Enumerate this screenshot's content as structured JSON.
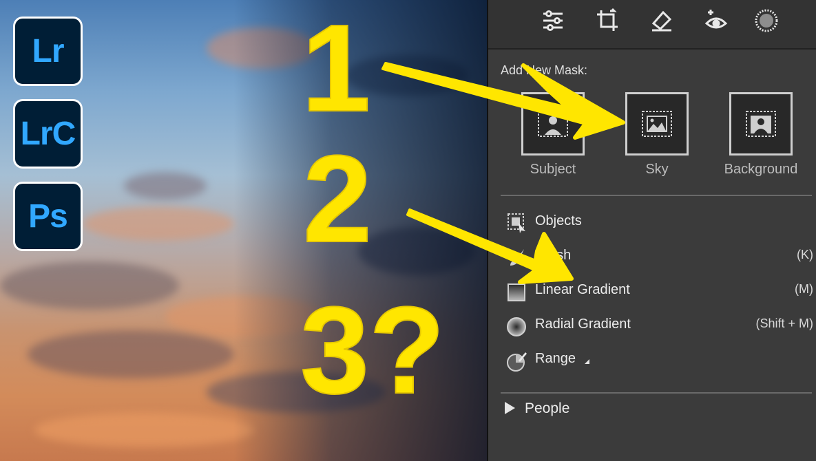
{
  "apps": [
    {
      "name": "lightroom-icon",
      "label": "Lr"
    },
    {
      "name": "lightroom-classic-icon",
      "label": "LrC"
    },
    {
      "name": "photoshop-icon",
      "label": "Ps"
    }
  ],
  "overlay": {
    "num1": "1",
    "num2": "2",
    "num3": "3?"
  },
  "toolbar": {
    "tools": [
      "sliders-icon",
      "crop-icon",
      "eraser-icon",
      "redeye-icon",
      "masking-icon"
    ]
  },
  "mask": {
    "add_label": "Add New Mask:",
    "buttons": [
      {
        "label": "Subject"
      },
      {
        "label": "Sky"
      },
      {
        "label": "Background"
      }
    ]
  },
  "tools_list": [
    {
      "label": "Objects",
      "key": ""
    },
    {
      "label": "Brush",
      "key": "(K)"
    },
    {
      "label": "Linear Gradient",
      "key": "(M)"
    },
    {
      "label": "Radial Gradient",
      "key": "(Shift + M)"
    },
    {
      "label": "Range",
      "key": ""
    }
  ],
  "people": {
    "label": "People"
  },
  "colors": {
    "accent_yellow": "#ffe600",
    "panel_bg": "#3b3b3b",
    "adobe_blue": "#31a8ff",
    "adobe_navy": "#001e36"
  }
}
